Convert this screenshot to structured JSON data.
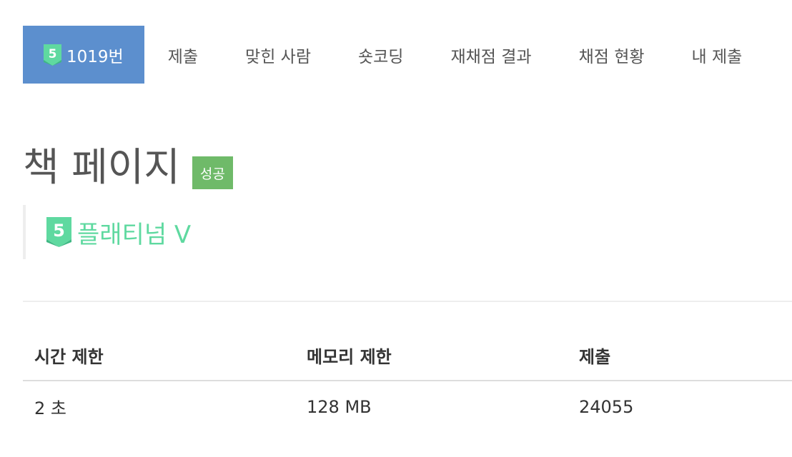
{
  "nav": {
    "tabs": [
      {
        "label": "1019번",
        "active": true,
        "tier_icon": "platinum-5-icon"
      },
      {
        "label": "제출"
      },
      {
        "label": "맞힌 사람"
      },
      {
        "label": "숏코딩"
      },
      {
        "label": "재채점 결과"
      },
      {
        "label": "채점 현황"
      },
      {
        "label": "내 제출"
      }
    ],
    "tier_number": "5"
  },
  "problem": {
    "title": "책 페이지",
    "status_badge": "성공",
    "tier_label": "플래티넘 V",
    "tier_number": "5"
  },
  "info_table": {
    "headers": [
      "시간 제한",
      "메모리 제한",
      "제출"
    ],
    "values": [
      "2 초",
      "128 MB",
      "24055"
    ]
  },
  "colors": {
    "active_tab": "#5c8fce",
    "success_badge": "#6fba69",
    "platinum": "#5fd9a0"
  }
}
